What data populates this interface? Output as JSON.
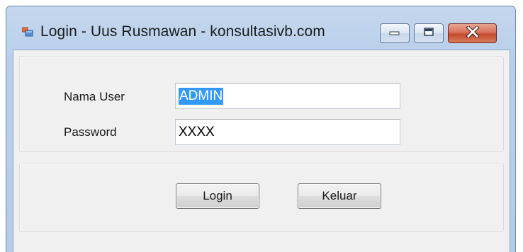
{
  "window": {
    "title": "Login - Uus Rusmawan - konsultasivb.com",
    "icon": "application-window-icon",
    "controls": {
      "minimize": "minimize-icon",
      "maximize": "maximize-icon",
      "close": "close-icon"
    }
  },
  "form": {
    "username_label": "Nama User",
    "username_value": "ADMIN",
    "password_label": "Password",
    "password_value": "XXXX"
  },
  "buttons": {
    "login_label": "Login",
    "exit_label": "Keluar"
  },
  "colors": {
    "selection": "#3399ff",
    "close_button": "#c44b2f",
    "frame": "#b9cfe9"
  }
}
